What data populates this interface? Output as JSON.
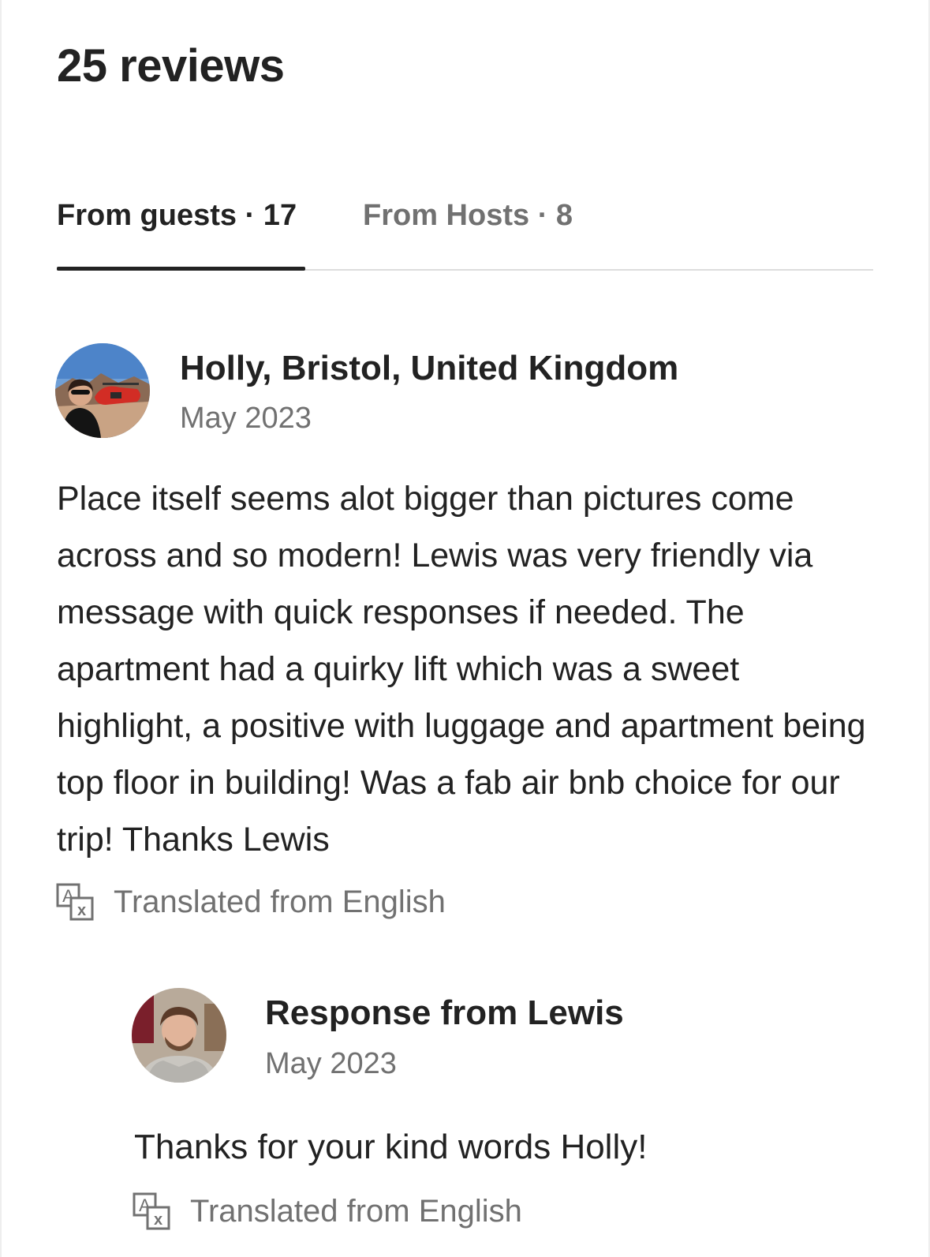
{
  "header": {
    "title": "25 reviews"
  },
  "tabs": [
    {
      "label": "From guests · 17",
      "active": true
    },
    {
      "label": "From Hosts · 8",
      "active": false
    }
  ],
  "review": {
    "author": "Holly, Bristol, United Kingdom",
    "date": "May 2023",
    "text": "Place itself seems alot bigger than pictures come across and so modern! Lewis was very friendly via message with quick responses if needed. The apartment had a quirky lift which was a sweet highlight, a positive with luggage and apartment being top floor in building! Was a fab air bnb choice for our trip! Thanks Lewis",
    "translated_label": "Translated from English",
    "avatar_icon": "guest-photo-avatar"
  },
  "response": {
    "title": "Response from Lewis",
    "date": "May 2023",
    "text": "Thanks for your kind words Holly!",
    "translated_label": "Translated from English",
    "avatar_icon": "host-photo-avatar"
  },
  "colors": {
    "primary_text": "#222222",
    "secondary_text": "#717171",
    "divider": "#dddddd"
  },
  "icons": {
    "translate": "translate-icon"
  }
}
